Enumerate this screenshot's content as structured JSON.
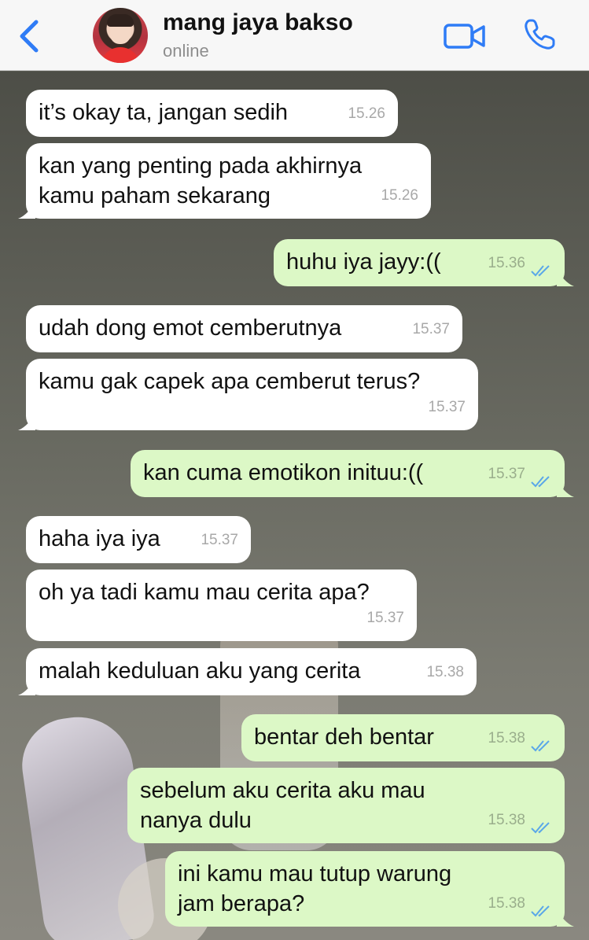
{
  "header": {
    "contact_name": "mang jaya bakso",
    "status": "online",
    "accent_color": "#2f7cf6"
  },
  "icons": [
    "chevron-left-icon",
    "video-call-icon",
    "phone-icon",
    "double-check-icon"
  ],
  "messages": [
    {
      "side": "in",
      "text": "it’s okay ta, jangan sedih",
      "time": "15.26"
    },
    {
      "side": "in",
      "text": "kan yang penting pada akhirnya kamu paham sekarang",
      "time": "15.26"
    },
    {
      "side": "out",
      "text": "huhu iya jayy:((",
      "time": "15.36"
    },
    {
      "side": "in",
      "text": "udah dong emot cemberutnya",
      "time": "15.37"
    },
    {
      "side": "in",
      "text": "kamu gak capek apa cemberut terus?",
      "time": "15.37"
    },
    {
      "side": "out",
      "text": "kan cuma emotikon inituu:((",
      "time": "15.37"
    },
    {
      "side": "in",
      "text": "haha iya iya",
      "time": "15.37"
    },
    {
      "side": "in",
      "text": "oh ya tadi kamu mau cerita apa?",
      "time": "15.37"
    },
    {
      "side": "in",
      "text": "malah keduluan aku yang cerita",
      "time": "15.38"
    },
    {
      "side": "out",
      "text": "bentar deh bentar",
      "time": "15.38"
    },
    {
      "side": "out",
      "text": "sebelum aku cerita aku mau nanya dulu",
      "time": "15.38"
    },
    {
      "side": "out",
      "text": "ini kamu mau tutup warung jam berapa?",
      "time": "15.38"
    }
  ]
}
